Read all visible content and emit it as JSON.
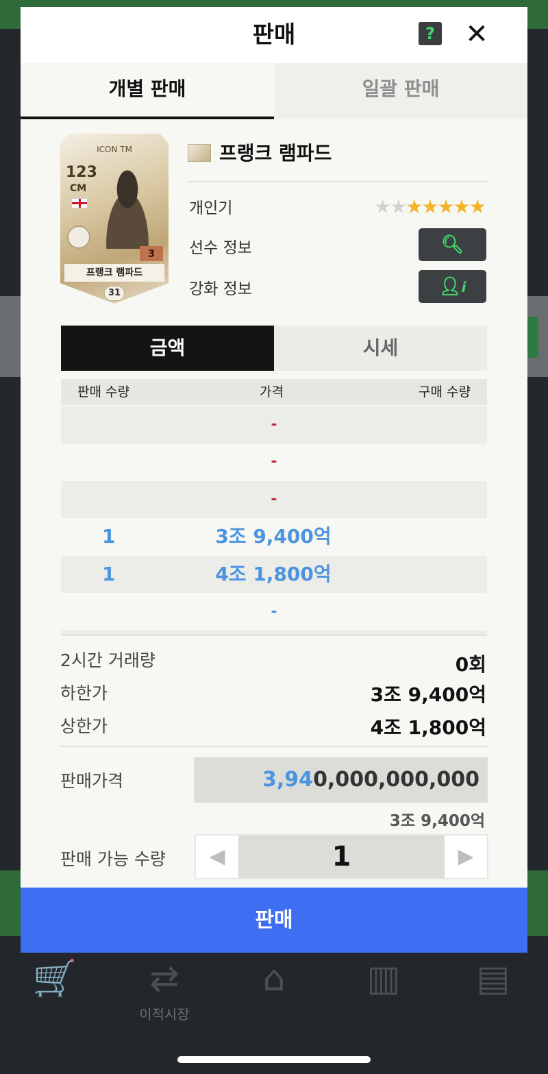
{
  "modal": {
    "title": "판매",
    "help_label": "?",
    "close_label": "✕"
  },
  "tabs": [
    {
      "label": "개별 판매",
      "active": true
    },
    {
      "label": "일괄 판매",
      "active": false
    }
  ],
  "card": {
    "tier": "ICON TM",
    "ovr": "123",
    "position": "CM",
    "level": "3",
    "name": "프랭크 램파드",
    "number": "31"
  },
  "player": {
    "name": "프랭크 램파드",
    "popularity_label": "개인기",
    "popularity_stars_total": 7,
    "popularity_stars_filled": 5,
    "player_info_label": "선수 정보",
    "upgrade_info_label": "강화 정보"
  },
  "price_tabs": [
    {
      "label": "금액",
      "active": true
    },
    {
      "label": "시세",
      "active": false
    }
  ],
  "order_table": {
    "headers": [
      "판매 수량",
      "가격",
      "구매 수량"
    ],
    "rows": [
      {
        "sell_qty": "",
        "price": "-",
        "buy_qty": ""
      },
      {
        "sell_qty": "",
        "price": "-",
        "buy_qty": ""
      },
      {
        "sell_qty": "",
        "price": "-",
        "buy_qty": ""
      },
      {
        "sell_qty": "1",
        "price": "3조 9,400억",
        "buy_qty": ""
      },
      {
        "sell_qty": "1",
        "price": "4조 1,800억",
        "buy_qty": ""
      },
      {
        "sell_qty": "",
        "price": "-",
        "buy_qty": ""
      }
    ]
  },
  "stats": {
    "volume_label": "2시간 거래량",
    "volume_value": "0회",
    "min_label": "하한가",
    "min_value": "3조 9,400억",
    "max_label": "상한가",
    "max_value": "4조 1,800억"
  },
  "sell_price": {
    "label": "판매가격",
    "value_highlight": "3,94",
    "value_rest": "0,000,000,000",
    "readable": "3조 9,400억"
  },
  "quantity": {
    "label": "판매 가능 수량",
    "value": "1",
    "dec_label": "◀",
    "inc_label": "▶"
  },
  "sell_button": "판매",
  "bottom_nav": {
    "transfer_market_label": "이적시장"
  },
  "colors": {
    "accent_blue": "#3e6ff2",
    "price_blue": "#4c94e0",
    "star_gold": "#f3b42b",
    "icon_green": "#41d96c"
  }
}
